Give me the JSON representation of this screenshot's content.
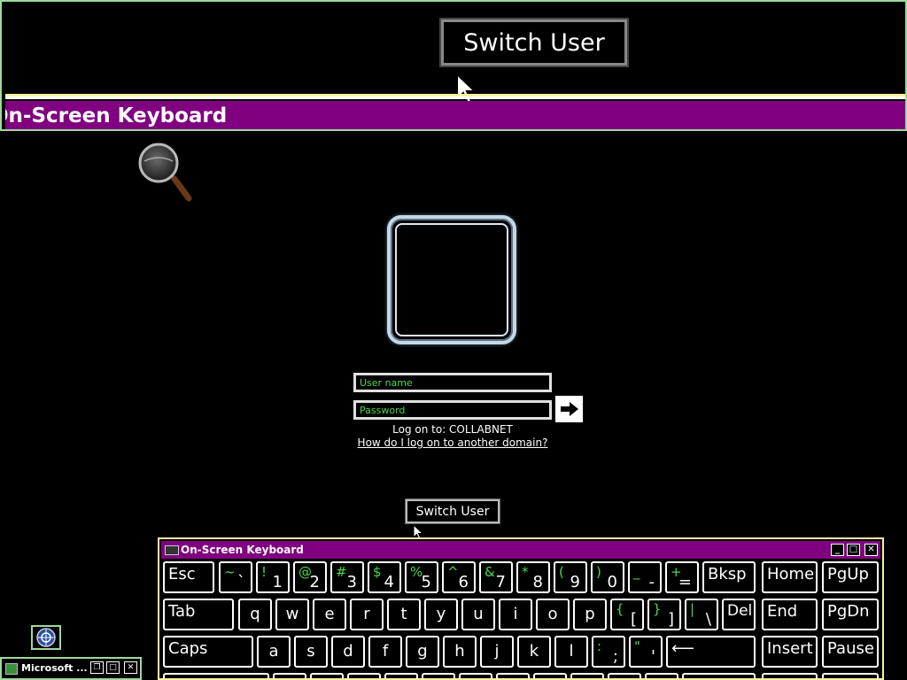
{
  "magnifier": {
    "switch_user_label": "Switch User",
    "title_fragment": "On-Screen Keyboard"
  },
  "logon": {
    "username_placeholder": "User name",
    "password_placeholder": "Password",
    "log_on_to": "Log on to: COLLABNET",
    "domain_link": "How do I log on to another domain?",
    "switch_user_label": "Switch User"
  },
  "osk": {
    "title": "On-Screen Keyboard",
    "minimize": "_",
    "maximize": "□",
    "close": "✕",
    "keys": {
      "esc": "Esc",
      "tilde_s": "~",
      "tilde": "`",
      "k1_s": "!",
      "k1": "1",
      "k2_s": "@",
      "k2": "2",
      "k3_s": "#",
      "k3": "3",
      "k4_s": "$",
      "k4": "4",
      "k5_s": "%",
      "k5": "5",
      "k6_s": "^",
      "k6": "6",
      "k7_s": "&",
      "k7": "7",
      "k8_s": "*",
      "k8": "8",
      "k9_s": "(",
      "k9": "9",
      "k0_s": ")",
      "k0": "0",
      "minus_s": "_",
      "minus": "-",
      "plus_s": "+",
      "plus": "=",
      "bksp": "Bksp",
      "home": "Home",
      "pgup": "PgUp",
      "tab": "Tab",
      "q": "q",
      "w": "w",
      "e": "e",
      "r": "r",
      "t": "t",
      "y": "y",
      "u": "u",
      "i": "i",
      "o": "o",
      "p": "p",
      "lbrace_s": "{",
      "lbrace": "[",
      "rbrace_s": "}",
      "rbrace": "]",
      "pipe_s": "|",
      "pipe": "\\",
      "del": "Del",
      "end": "End",
      "pgdn": "PgDn",
      "caps": "Caps",
      "a": "a",
      "s": "s",
      "d": "d",
      "f": "f",
      "g": "g",
      "h": "h",
      "j": "j",
      "k": "k",
      "l": "l",
      "colon_s": ":",
      "colon": ";",
      "quote_s": "\"",
      "quote": "'",
      "enter": "⟵",
      "insert": "Insert",
      "pause": "Pause"
    }
  },
  "taskbar": {
    "button_label": "Microsoft ..."
  }
}
